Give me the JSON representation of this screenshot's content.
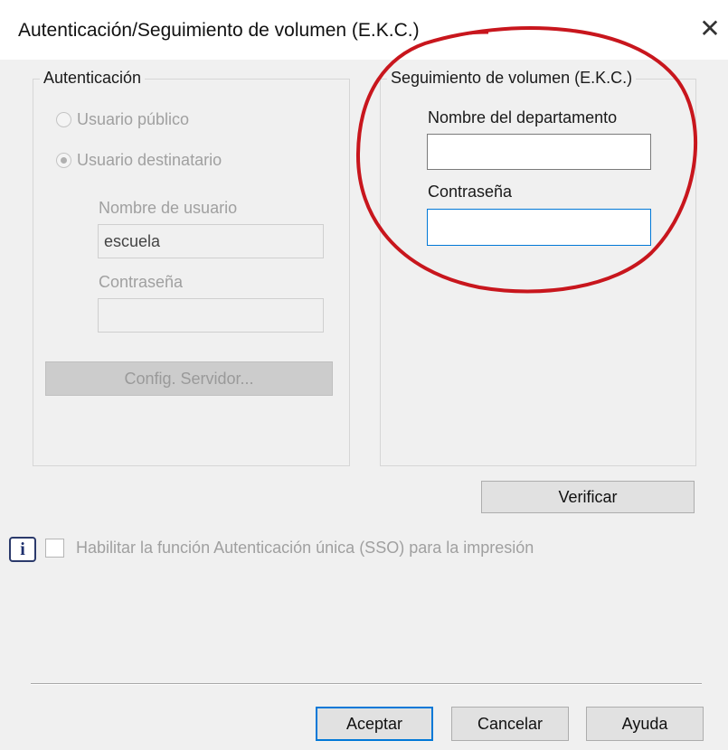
{
  "window": {
    "title": "Autenticación/Seguimiento de volumen (E.K.C.)",
    "close_glyph": "✕"
  },
  "auth": {
    "legend": "Autenticación",
    "public_user_label": "Usuario público",
    "target_user_label": "Usuario destinatario",
    "selected_option": "Usuario destinatario",
    "username_label": "Nombre de usuario",
    "username_value": "escuela",
    "password_label": "Contraseña",
    "password_value": "",
    "server_button": "Config. Servidor..."
  },
  "ekc": {
    "legend": "Seguimiento de volumen (E.K.C.)",
    "department_label": "Nombre del departamento",
    "department_value": "",
    "password_label": "Contraseña",
    "password_value": ""
  },
  "verify_button": "Verificar",
  "sso": {
    "info_glyph": "i",
    "label": "Habilitar la función Autenticación única (SSO) para la impresión",
    "checked": false
  },
  "footer": {
    "ok": "Aceptar",
    "cancel": "Cancelar",
    "help": "Ayuda"
  },
  "colors": {
    "annotation": "#c8161d",
    "focus": "#0078d7"
  },
  "icons": {
    "close": "close-icon",
    "info": "info-icon"
  }
}
